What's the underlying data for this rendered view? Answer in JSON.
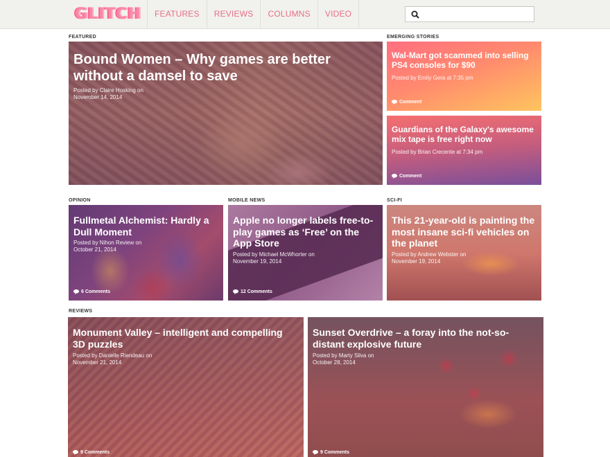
{
  "header": {
    "logo": "GLITCH",
    "nav": [
      "FEATURES",
      "REVIEWS",
      "COLUMNS",
      "VIDEO"
    ],
    "search_placeholder": ""
  },
  "featured": {
    "label": "FEATURED",
    "title": "Bound Women – Why games are better without a damsel to save",
    "meta_line1": "Posted by Claire Hosking on",
    "meta_line2": "November 14, 2014"
  },
  "emerging": {
    "label": "EMERGING STORIES",
    "items": [
      {
        "title": "Wal-Mart got scammed into selling PS4 consoles for $90",
        "meta": "Posted by Emily Gera at 7:35 pm",
        "comments": "Comment"
      },
      {
        "title": "Guardians of the Galaxy's awesome mix tape is free right now",
        "meta": "Posted by Brian Crecente at 7:34 pm",
        "comments": "Comment"
      }
    ]
  },
  "row2": [
    {
      "label": "OPINION",
      "title": "Fullmetal Alchemist: Hardly a Dull Moment",
      "meta_line1": "Posted by Nihon Review on",
      "meta_line2": "October 21, 2014",
      "comments": "6 Comments"
    },
    {
      "label": "MOBILE NEWS",
      "title": "Apple no longer labels free-to-play games as ‘Free’ on the App Store",
      "meta_line1": "Posted by Michael McWhorter on",
      "meta_line2": "November 19, 2014",
      "comments": "12 Comments"
    },
    {
      "label": "SCI-FI",
      "title": "This 21-year-old is painting the most insane sci-fi vehicles on the planet",
      "meta_line1": "Posted by Andrew Webster on",
      "meta_line2": "November 19, 2014",
      "comments": ""
    }
  ],
  "reviews": {
    "label": "REVIEWS",
    "items": [
      {
        "title": "Monument Valley – intelligent and compelling 3D puzzles",
        "meta_line1": "Posted by Danielle Riendeau on",
        "meta_line2": "November 21, 2014",
        "comments": "9 Comments"
      },
      {
        "title": "Sunset Overdrive – a foray into the not-so-distant explosive future",
        "meta_line1": "Posted by Marty Sliva on",
        "meta_line2": "October 28, 2014",
        "comments": "9 Comments"
      }
    ]
  },
  "colors": {
    "accent": "#e86f86",
    "header_bg": "#f1f1ed",
    "emerging_1_top": "#ff6f7a",
    "emerging_1_bottom": "#ffc35e",
    "emerging_2_top": "#f06e72",
    "emerging_2_bottom": "#7a4f9a"
  },
  "icons": [
    "search-icon",
    "comment-bubble-icon"
  ]
}
